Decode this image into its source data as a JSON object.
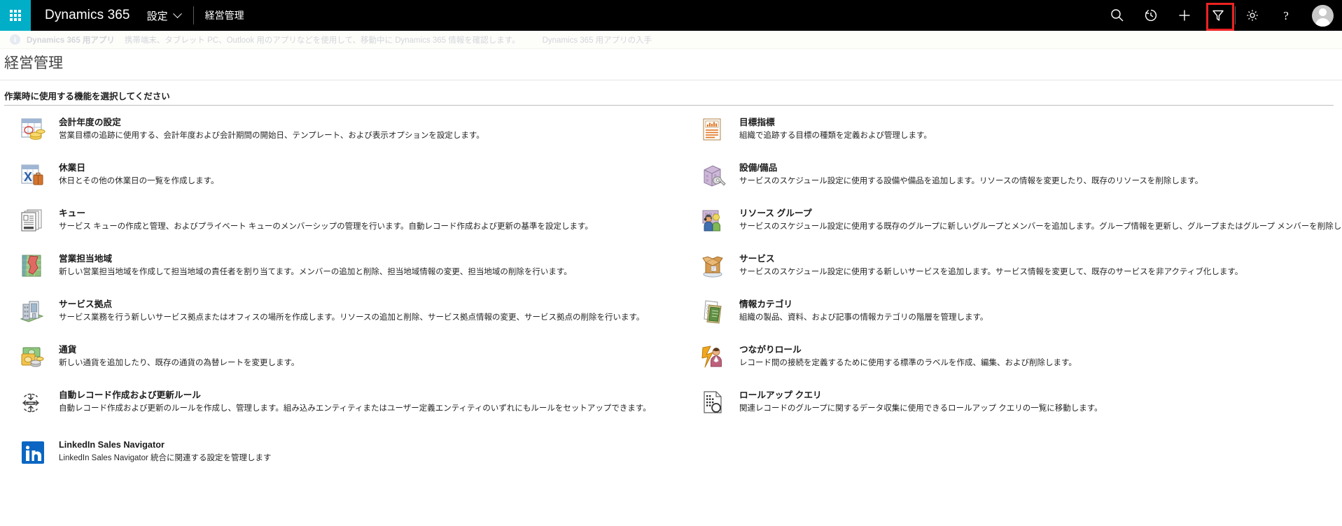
{
  "topnav": {
    "waffle_label": "app-launcher",
    "brand": "Dynamics 365",
    "app_name": "設定",
    "breadcrumb": "経営管理",
    "actions": [
      {
        "icon": "search-icon",
        "label": "検索"
      },
      {
        "icon": "history-icon",
        "label": "最近使用した項目"
      },
      {
        "icon": "plus-icon",
        "label": "新規作成"
      },
      {
        "icon": "filter-icon",
        "label": "フィルター",
        "highlighted": true
      },
      {
        "icon": "gear-icon",
        "label": "設定"
      },
      {
        "icon": "help-icon",
        "label": "ヘルプ"
      }
    ],
    "avatar_label": "ユーザー"
  },
  "banner": {
    "strong": "Dynamics 365 用アプリ",
    "text": "携帯端末、タブレット PC、Outlook 用のアプリなどを使用して、移動中に Dynamics 365 情報を確認します。",
    "link": "Dynamics 365 用アプリの入手"
  },
  "page": {
    "title": "経営管理",
    "section_heading": "作業時に使用する機能を選択してください"
  },
  "colors": {
    "accent": "#00aec7",
    "topbar_bg": "#000000",
    "highlight": "#ee2222",
    "linkedin": "#0a66c2"
  },
  "tiles_left": [
    {
      "icon": "fiscal-year-icon",
      "title": "会計年度の設定",
      "desc": "営業目標の追跡に使用する、会計年度および会計期間の開始日、テンプレート、および表示オプションを設定します。"
    },
    {
      "icon": "holiday-icon",
      "title": "休業日",
      "desc": "休日とその他の休業日の一覧を作成します。"
    },
    {
      "icon": "queue-icon",
      "title": "キュー",
      "desc": "サービス キューの作成と管理、およびプライベート キューのメンバーシップの管理を行います。自動レコード作成および更新の基準を設定します。"
    },
    {
      "icon": "sales-territory-icon",
      "title": "営業担当地域",
      "desc": "新しい営業担当地域を作成して担当地域の責任者を割り当てます。メンバーの追加と削除、担当地域情報の変更、担当地域の削除を行います。"
    },
    {
      "icon": "service-site-icon",
      "title": "サービス拠点",
      "desc": "サービス業務を行う新しいサービス拠点またはオフィスの場所を作成します。リソースの追加と削除、サービス拠点情報の変更、サービス拠点の削除を行います。"
    },
    {
      "icon": "currency-icon",
      "title": "通貨",
      "desc": "新しい通貨を追加したり、既存の通貨の為替レートを変更します。"
    },
    {
      "icon": "auto-record-rule-icon",
      "title": "自動レコード作成および更新ルール",
      "desc": "自動レコード作成および更新のルールを作成し、管理します。組み込みエンティティまたはユーザー定義エンティティのいずれにもルールをセットアップできます。"
    },
    {
      "icon": "linkedin-icon",
      "title": "LinkedIn Sales Navigator",
      "desc": "LinkedIn Sales Navigator 統合に関連する設定を管理します"
    }
  ],
  "tiles_right": [
    {
      "icon": "goal-metric-icon",
      "title": "目標指標",
      "desc": "組織で追跡する目標の種類を定義および管理します。"
    },
    {
      "icon": "facility-equipment-icon",
      "title": "設備/備品",
      "desc": "サービスのスケジュール設定に使用する設備や備品を追加します。リソースの情報を変更したり、既存のリソースを削除します。"
    },
    {
      "icon": "resource-group-icon",
      "title": "リソース グループ",
      "desc": "サービスのスケジュール設定に使用する既存のグループに新しいグループとメンバーを追加します。グループ情報を更新し、グループまたはグループ メンバーを削除します。"
    },
    {
      "icon": "service-icon",
      "title": "サービス",
      "desc": "サービスのスケジュール設定に使用する新しいサービスを追加します。サービス情報を変更して、既存のサービスを非アクティブ化します。"
    },
    {
      "icon": "subject-category-icon",
      "title": "情報カテゴリ",
      "desc": "組織の製品、資料、および記事の情報カテゴリの階層を管理します。"
    },
    {
      "icon": "connection-role-icon",
      "title": "つながりロール",
      "desc": "レコード間の接続を定義するために使用する標準のラベルを作成、編集、および削除します。"
    },
    {
      "icon": "rollup-query-icon",
      "title": "ロールアップ クエリ",
      "desc": "関連レコードのグループに関するデータ収集に使用できるロールアップ クエリの一覧に移動します。"
    }
  ]
}
